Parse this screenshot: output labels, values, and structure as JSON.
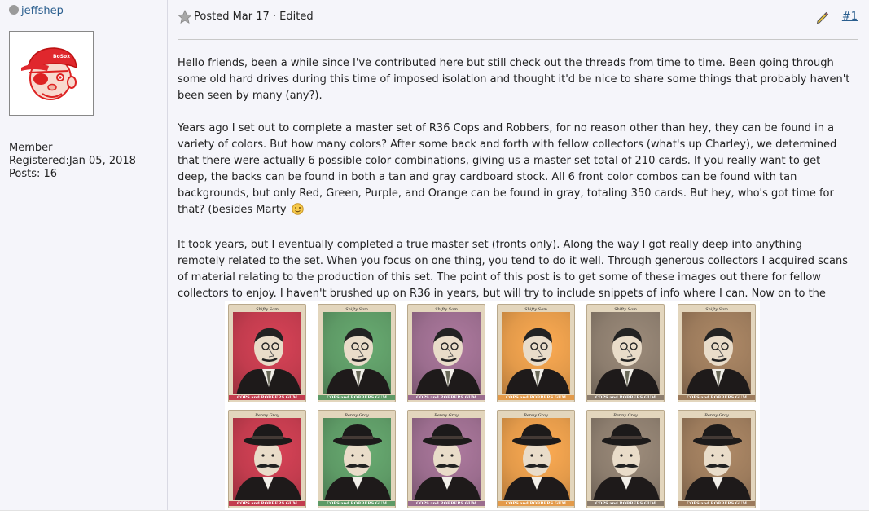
{
  "user": {
    "username": "jeffshep",
    "status_icon": "offline-dot",
    "rank": "Member",
    "registered": "Registered:Jan 05, 2018",
    "posts": "Posts: 16",
    "avatar_cap_text": "BoSox"
  },
  "post": {
    "meta": "Posted Mar 17 · Edited",
    "number": "#1",
    "paragraphs": [
      [
        "Hello friends, been a while since I've contributed here but still check out the threads from time to time. Been going through",
        "some old hard drives during this time of imposed isolation and thought it'd be nice to share some things that probably haven't",
        "been seen by many (any?)."
      ],
      [
        "Years ago I set out to complete a master set of R36 Cops and Robbers, for no reason other than hey, they can be found in a",
        "variety of colors. But how many colors? After some back and forth with fellow collectors (what's up Charley), we determined",
        "that there were actually 6 possible color combinations, giving us a master set total of 210 cards. If you really want to get",
        "deep, the backs can be found in both a tan and gray cardboard stock. All 6 front color combos can be found with tan",
        "backgrounds, but only Red, Green, Purple, and Orange can be found in gray, totaling 350 cards. But hey, who's got time for",
        "that? (besides Marty "
      ],
      [
        "It took years, but I eventually completed a true master set (fronts only). Along the way I got really deep into anything",
        "remotely related to the set. When you focus on one thing, you tend to do it well. Through generous collectors I acquired scans",
        "of material relating to the production of this set. The point of this post is to get some of these images out there for fellow",
        "collectors to enjoy. I haven't brushed up on R36 in years, but will try to include snippets of info where I can. Now on to the"
      ]
    ]
  },
  "cards": {
    "top_name": "Shifty Sam",
    "bottom_name": "Benny Gray",
    "brand": "COPS and ROBBERS GUM",
    "colors": [
      "#c23c4e",
      "#5e9a66",
      "#9b6d8e",
      "#e39a4a",
      "#8c7d6e",
      "#9c7b5c"
    ]
  },
  "colors": {
    "link": "#2a5e8e",
    "panel_bg": "#f5f5fa"
  }
}
